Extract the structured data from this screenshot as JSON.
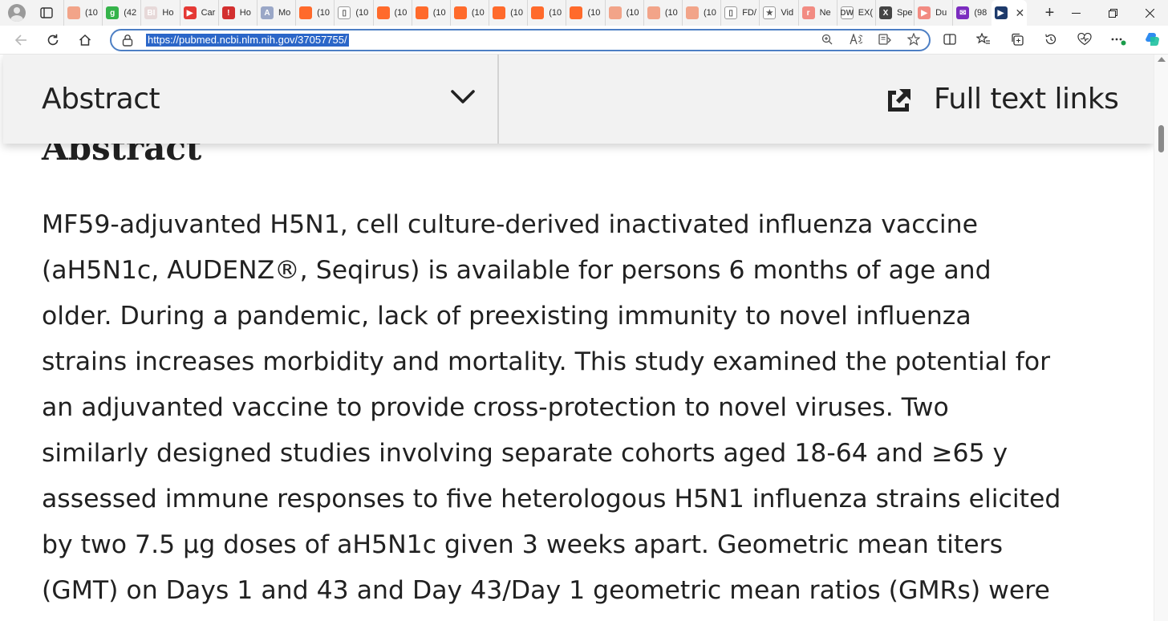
{
  "browser": {
    "tabs": [
      {
        "label": "(10",
        "color": "#f2a489",
        "glyph": ""
      },
      {
        "label": "(42",
        "color": "#35b34a",
        "glyph": "g"
      },
      {
        "label": "Ho",
        "color": "#e7d9d9",
        "glyph": "BI"
      },
      {
        "label": "Car",
        "color": "#e53935",
        "glyph": "▶"
      },
      {
        "label": "Ho",
        "color": "#d32f2f",
        "glyph": "!"
      },
      {
        "label": "Mo",
        "color": "#9aa7c7",
        "glyph": "A"
      },
      {
        "label": "(10",
        "color": "#ff6a2b",
        "glyph": ""
      },
      {
        "label": "(10",
        "color": "#ffffff",
        "glyph": "▯"
      },
      {
        "label": "(10",
        "color": "#ff6a2b",
        "glyph": ""
      },
      {
        "label": "(10",
        "color": "#ff6a2b",
        "glyph": ""
      },
      {
        "label": "(10",
        "color": "#ff6a2b",
        "glyph": ""
      },
      {
        "label": "(10",
        "color": "#ff6a2b",
        "glyph": ""
      },
      {
        "label": "(10",
        "color": "#ff6a2b",
        "glyph": ""
      },
      {
        "label": "(10",
        "color": "#ff6a2b",
        "glyph": ""
      },
      {
        "label": "(10",
        "color": "#f2a489",
        "glyph": ""
      },
      {
        "label": "(10",
        "color": "#f2a489",
        "glyph": ""
      },
      {
        "label": "(10",
        "color": "#f2a489",
        "glyph": ""
      },
      {
        "label": "FD/",
        "color": "#ffffff",
        "glyph": "▯"
      },
      {
        "label": "Vid",
        "color": "#ffffff",
        "glyph": "★"
      },
      {
        "label": "Ne",
        "color": "#f28b82",
        "glyph": "r"
      },
      {
        "label": "EX(",
        "color": "#ffffff",
        "glyph": "DW"
      },
      {
        "label": "Spe",
        "color": "#444444",
        "glyph": "X"
      },
      {
        "label": "Du",
        "color": "#f28b82",
        "glyph": "▶"
      },
      {
        "label": "(98",
        "color": "#7b2cbf",
        "glyph": "✉"
      }
    ],
    "active_tab_close": "✕",
    "new_tab": "+",
    "url": "https://pubmed.ncbi.nlm.nih.gov/37057755/"
  },
  "sticky_nav": {
    "section_label": "Abstract",
    "full_text_label": "Full text links"
  },
  "article": {
    "heading": "Abstract",
    "lines": [
      "MF59-adjuvanted H5N1, cell culture-derived inactivated influenza vaccine",
      "(aH5N1c, AUDENZ®, Seqirus) is available for persons 6 months of age and",
      "older. During a pandemic, lack of preexisting immunity to novel influenza",
      "strains increases morbidity and mortality. This study examined the potential for",
      "an adjuvanted vaccine to provide cross-protection to novel viruses. Two",
      "similarly designed studies involving separate cohorts aged 18-64 and ≥65 y",
      "assessed immune responses to five heterologous H5N1 influenza strains elicited",
      "by two 7.5 µg doses of aH5N1c given 3 weeks apart. Geometric mean titers",
      "(GMT) on Days 1 and 43 and Day 43/Day 1 geometric mean ratios (GMRs) were"
    ]
  }
}
